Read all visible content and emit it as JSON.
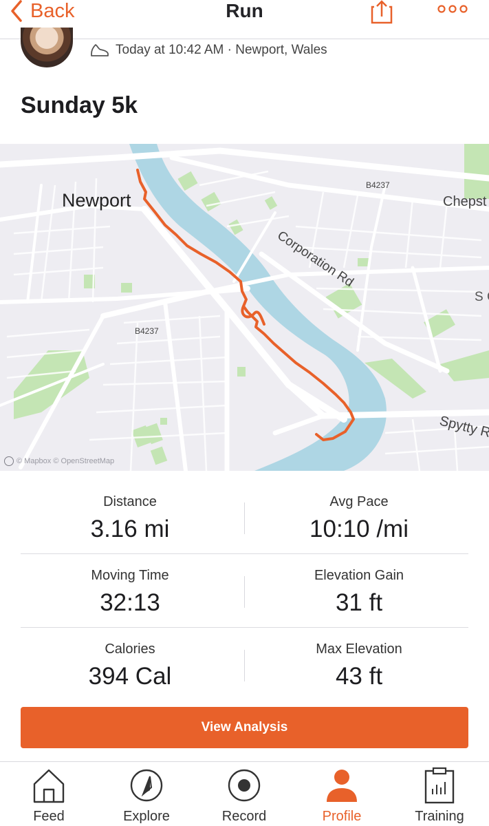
{
  "header": {
    "back_label": "Back",
    "title": "Run",
    "share_icon": "share-icon",
    "more_icon": "more-options-icon"
  },
  "activity": {
    "meta": "Today at 10:42 AM · Newport, Wales",
    "type_icon": "shoe-icon",
    "title": "Sunday 5k"
  },
  "map": {
    "city_label": "Newport",
    "road_labels": [
      "B4237",
      "B4237",
      "Corporation Rd",
      "Chepst",
      "Spytty R",
      "S C"
    ],
    "attribution": "© Mapbox © OpenStreetMap",
    "route_color": "#e8612a",
    "water_color": "#aed6e4",
    "park_color": "#c4e5b4"
  },
  "stats": [
    {
      "left": {
        "label": "Distance",
        "value": "3.16 mi"
      },
      "right": {
        "label": "Avg Pace",
        "value": "10:10 /mi"
      }
    },
    {
      "left": {
        "label": "Moving Time",
        "value": "32:13"
      },
      "right": {
        "label": "Elevation Gain",
        "value": "31 ft"
      }
    },
    {
      "left": {
        "label": "Calories",
        "value": "394 Cal"
      },
      "right": {
        "label": "Max Elevation",
        "value": "43 ft"
      }
    }
  ],
  "analysis_button": "View Analysis",
  "tabs": [
    {
      "label": "Feed",
      "icon": "home-icon"
    },
    {
      "label": "Explore",
      "icon": "compass-icon"
    },
    {
      "label": "Record",
      "icon": "record-icon"
    },
    {
      "label": "Profile",
      "icon": "profile-icon",
      "active": true
    },
    {
      "label": "Training",
      "icon": "clipboard-icon"
    }
  ],
  "colors": {
    "accent": "#e8612a",
    "text": "#242428"
  }
}
